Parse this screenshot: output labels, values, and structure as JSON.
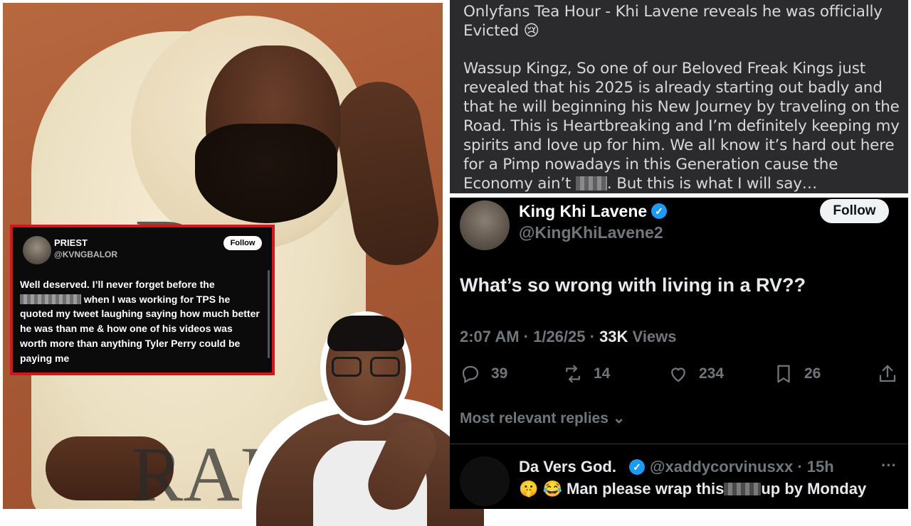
{
  "left_post": {
    "name": "PRIEST",
    "handle": "@KVNGBALOR",
    "follow_label": "Follow",
    "body_part1": "Well deserved. I’ll never forget before the",
    "body_part2": "when I was working for TPS he quoted my tweet laughing saying how much better he was than me & how one of his videos was worth more than anything Tyler Perry could be paying me"
  },
  "photo": {
    "hoodie_print_top": "D",
    "hoodie_print_bottom": "RAI"
  },
  "post": {
    "title": "Onlyfans Tea Hour - Khi Lavene reveals he was officially Evicted 😢",
    "body_part1": "Wassup Kingz, So one of our Beloved Freak Kings just revealed that his 2025 is already starting out badly and that he will beginning his New Journey by traveling on the Road. This is Heartbreaking and I’m definitely keeping my spirits and love up for him. We all know it’s hard out here for a Pimp nowadays in this Generation cause the Economy ain’t",
    "body_part2": ". But this is what I will say…"
  },
  "tweet": {
    "name": "King Khi Lavene",
    "handle": "@KingKhiLavene2",
    "follow_label": "Follow",
    "text": "What’s so wrong with living in a RV??",
    "time": "2:07 AM · 1/26/25 ·",
    "views_count": "33K",
    "views_label": "Views",
    "stats": {
      "replies": "39",
      "reposts": "14",
      "likes": "234",
      "bookmarks": "26"
    },
    "replies_sort": "Most relevant replies",
    "replies_sort_chevron": "⌄"
  },
  "reply": {
    "name": "Da Vers God.",
    "handle": "@xaddycorvinusxx · 15h",
    "more": "···",
    "emoji_prefix": "🤫 😂",
    "text_part1": "Man please wrap this",
    "text_part2": "up by Monday"
  },
  "colors": {
    "priest_border": "#d4151b",
    "verified_badge": "#1d9bf0",
    "tweet_bg": "#000000",
    "post_bg": "#2b2b2d",
    "photo_bg": "#a85a36"
  },
  "icons": [
    "reply-icon",
    "repost-icon",
    "like-icon",
    "bookmark-icon",
    "share-icon",
    "verified-icon"
  ]
}
